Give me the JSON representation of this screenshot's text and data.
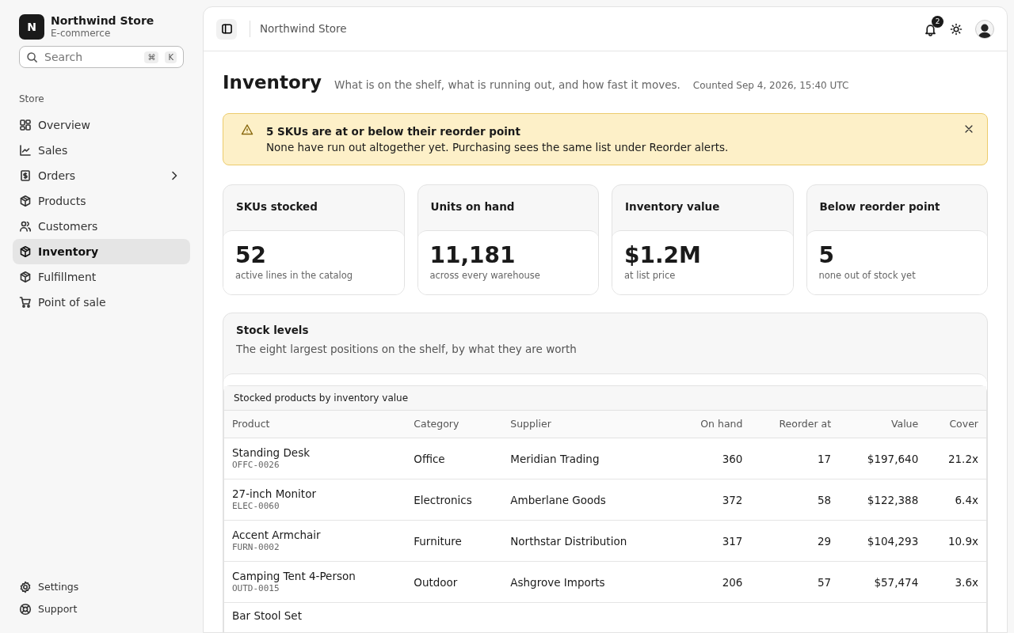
{
  "brand": {
    "initial": "N",
    "name": "Northwind Store",
    "subtitle": "E-commerce"
  },
  "search": {
    "placeholder": "Search",
    "keys": [
      "⌘",
      "K"
    ]
  },
  "sidebar": {
    "section": "Store",
    "items": [
      {
        "label": "Overview",
        "kind": "grid",
        "selected": false
      },
      {
        "label": "Sales",
        "kind": "chart",
        "selected": false
      },
      {
        "label": "Orders",
        "kind": "dollar",
        "selected": false,
        "expandable": true
      },
      {
        "label": "Products",
        "kind": "box",
        "selected": false
      },
      {
        "label": "Customers",
        "kind": "users",
        "selected": false
      },
      {
        "label": "Inventory",
        "kind": "box",
        "selected": true
      },
      {
        "label": "Fulfillment",
        "kind": "box",
        "selected": false
      },
      {
        "label": "Point of sale",
        "kind": "cart",
        "selected": false
      }
    ],
    "footer": [
      {
        "label": "Settings",
        "kind": "gear"
      },
      {
        "label": "Support",
        "kind": "lifebuoy"
      }
    ]
  },
  "topbar": {
    "breadcrumb": "Northwind Store",
    "notifications": "2"
  },
  "page": {
    "title": "Inventory",
    "subtitle": "What is on the shelf, what is running out, and how fast it moves.",
    "timestamp": "Counted Sep 4, 2026, 15:40 UTC"
  },
  "alert": {
    "title": "5 SKUs are at or below their reorder point",
    "body": "None have run out altogether yet. Purchasing sees the same list under Reorder alerts."
  },
  "stats": [
    {
      "label": "SKUs stocked",
      "value": "52",
      "note": "active lines in the catalog"
    },
    {
      "label": "Units on hand",
      "value": "11,181",
      "note": "across every warehouse"
    },
    {
      "label": "Inventory value",
      "value": "$1.2M",
      "note": "at list price"
    },
    {
      "label": "Below reorder point",
      "value": "5",
      "note": "none out of stock yet"
    }
  ],
  "stock": {
    "title": "Stock levels",
    "subtitle": "The eight largest positions on the shelf, by what they are worth",
    "table": {
      "caption": "Stocked products by inventory value",
      "columns": [
        "Product",
        "Category",
        "Supplier",
        "On hand",
        "Reorder at",
        "Value",
        "Cover"
      ],
      "rows": [
        {
          "product": "Standing Desk",
          "sku": "OFFC-0026",
          "category": "Office",
          "supplier": "Meridian Trading",
          "on_hand": "360",
          "reorder_at": "17",
          "value": "$197,640",
          "cover": "21.2x"
        },
        {
          "product": "27-inch Monitor",
          "sku": "ELEC-0060",
          "category": "Electronics",
          "supplier": "Amberlane Goods",
          "on_hand": "372",
          "reorder_at": "58",
          "value": "$122,388",
          "cover": "6.4x"
        },
        {
          "product": "Accent Armchair",
          "sku": "FURN-0002",
          "category": "Furniture",
          "supplier": "Northstar Distribution",
          "on_hand": "317",
          "reorder_at": "29",
          "value": "$104,293",
          "cover": "10.9x"
        },
        {
          "product": "Camping Tent 4-Person",
          "sku": "OUTD-0015",
          "category": "Outdoor",
          "supplier": "Ashgrove Imports",
          "on_hand": "206",
          "reorder_at": "57",
          "value": "$57,474",
          "cover": "3.6x"
        },
        {
          "product": "Bar Stool Set"
        }
      ]
    }
  }
}
